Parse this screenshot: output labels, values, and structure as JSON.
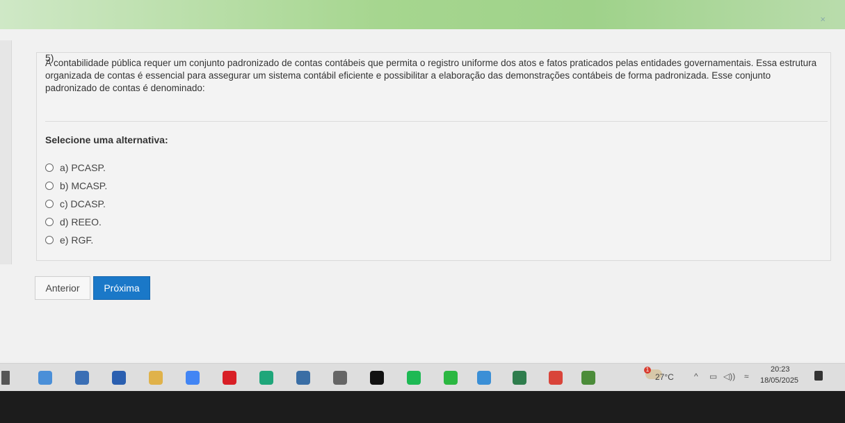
{
  "window": {
    "close_glyph": "×"
  },
  "question": {
    "number": "5)",
    "text": "A contabilidade pública requer um conjunto padronizado de contas contábeis que permita o registro uniforme dos atos e fatos praticados pelas entidades governamentais. Essa estrutura organizada de contas é essencial para assegurar um sistema contábil eficiente e possibilitar a elaboração das demonstrações contábeis de forma padronizada. Esse conjunto padronizado de contas é denominado:",
    "select_label": "Selecione uma alternativa:",
    "options": [
      {
        "label": "a) PCASP."
      },
      {
        "label": "b) MCASP."
      },
      {
        "label": "c) DCASP."
      },
      {
        "label": "d) REEO."
      },
      {
        "label": "e) RGF."
      }
    ]
  },
  "nav": {
    "prev_label": "Anterior",
    "next_label": "Próxima",
    "next_color": "#1a78c8"
  },
  "taskbar": {
    "icons": [
      {
        "name": "taskview-icon",
        "color": "#555555"
      },
      {
        "name": "copilot-icon",
        "color": "#4a8fd8"
      },
      {
        "name": "search-app-icon",
        "color": "#3b6fb5"
      },
      {
        "name": "store-icon",
        "color": "#2a5fb0"
      },
      {
        "name": "file-explorer-icon",
        "color": "#e0b24a"
      },
      {
        "name": "google-lens-icon",
        "color": "#4285f4"
      },
      {
        "name": "netflix-icon",
        "color": "#d81f26"
      },
      {
        "name": "edge-icon",
        "color": "#1fa67a"
      },
      {
        "name": "camera-icon",
        "color": "#3a6ea5"
      },
      {
        "name": "snipping-tool-icon",
        "color": "#666666"
      },
      {
        "name": "tiktok-icon",
        "color": "#111111"
      },
      {
        "name": "spotify-icon",
        "color": "#1db954"
      },
      {
        "name": "whatsapp-icon",
        "color": "#2bb741"
      },
      {
        "name": "photos-icon",
        "color": "#3b8fd6"
      },
      {
        "name": "game-icon",
        "color": "#2f7d4d"
      },
      {
        "name": "chrome-icon",
        "color": "#d9443a"
      },
      {
        "name": "minecraft-icon",
        "color": "#4c8c3a"
      }
    ],
    "weather_badge": "1",
    "temperature": "27°C",
    "tray": {
      "chevron": "^",
      "battery": "▭",
      "volume": "◁))",
      "wifi": "≈"
    },
    "time": "20:23",
    "date": "18/05/2025"
  }
}
